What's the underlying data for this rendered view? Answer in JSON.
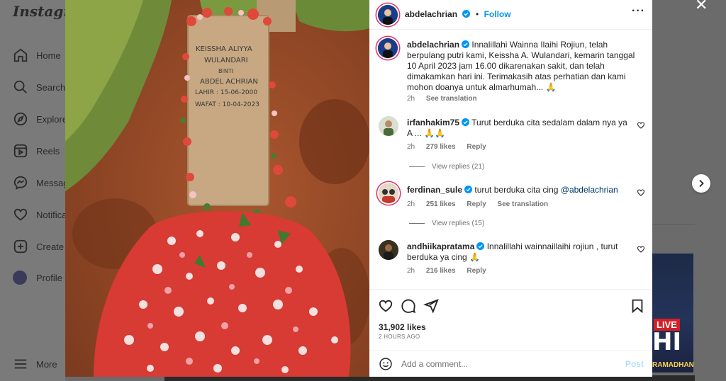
{
  "background": {
    "logo": "Instagram",
    "nav": [
      {
        "label": "Home",
        "icon": "home-icon"
      },
      {
        "label": "Search",
        "icon": "search-icon"
      },
      {
        "label": "Explore",
        "icon": "explore-icon"
      },
      {
        "label": "Reels",
        "icon": "reels-icon"
      },
      {
        "label": "Messages",
        "icon": "messenger-icon"
      },
      {
        "label": "Notifications",
        "icon": "heart-icon"
      },
      {
        "label": "Create",
        "icon": "plus-icon"
      },
      {
        "label": "Profile",
        "icon": "avatar"
      }
    ],
    "more_label": "More",
    "thumb_live": "LIVE",
    "thumb_big": "HI",
    "thumb_caption": "RAMADHAN"
  },
  "photo": {
    "headstone_lines": [
      "KEISSHA ALIYYA",
      "WULANDARI",
      "BINTI",
      "ABDEL ACHRIAN",
      "LAHIR : 15-06-2000",
      "WAFAT : 10-04-2023"
    ]
  },
  "post": {
    "author": "abdelachrian",
    "follow_label": "Follow",
    "caption": "Innalillahi Wainna Ilaihi Rojiun, telah berpulang putri kami, Keissha A. Wulandari, kemarin tanggal 10 April 2023 jam 16.00 dikarenakan sakit, dan telah dimakamkan hari ini. Terimakasih atas perhatian dan kami mohon doanya untuk almarhumah... 🙏",
    "caption_time": "2h",
    "see_translation": "See translation",
    "likes": "31,902 likes",
    "posted_ago": "2 HOURS AGO",
    "comment_placeholder": "Add a comment...",
    "post_label": "Post"
  },
  "comments": [
    {
      "username": "irfanhakim75",
      "text": "Turut berduka cita sedalam dalam nya ya A ... 🙏🙏",
      "time": "2h",
      "likes": "279 likes",
      "reply": "Reply",
      "view_replies": "View replies (21)"
    },
    {
      "username": "ferdinan_sule",
      "text": "turut berduka cita cing ",
      "mention": "@abdelachrian",
      "time": "2h",
      "likes": "251 likes",
      "reply": "Reply",
      "see_translation": "See translation",
      "view_replies": "View replies (15)"
    },
    {
      "username": "andhiikapratama",
      "text": "Innalillahi wainnaillaihi rojiun , turut berduka ya cing 🙏",
      "time": "2h",
      "likes": "216 likes",
      "reply": "Reply"
    }
  ],
  "colors": {
    "link_blue": "#0095f6",
    "verified_blue": "#0095f6",
    "story_ring": "#e1306c",
    "mention_blue": "#00376b"
  }
}
